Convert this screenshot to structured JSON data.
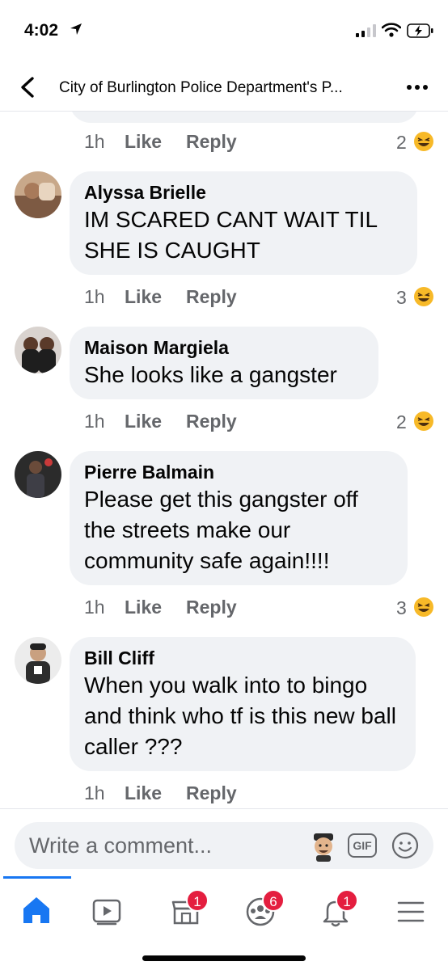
{
  "status_bar": {
    "time": "4:02"
  },
  "header": {
    "title": "City of Burlington Police Department's P..."
  },
  "comments": [
    {
      "name": "",
      "text": "",
      "time": "1h",
      "like": "Like",
      "reply": "Reply",
      "reactions": "2"
    },
    {
      "name": "Alyssa Brielle",
      "text": "IM SCARED CANT WAIT TIL SHE IS CAUGHT",
      "time": "1h",
      "like": "Like",
      "reply": "Reply",
      "reactions": "3"
    },
    {
      "name": "Maison Margiela",
      "text": "She looks like a gangster",
      "time": "1h",
      "like": "Like",
      "reply": "Reply",
      "reactions": "2"
    },
    {
      "name": "Pierre Balmain",
      "text": "Please get this gangster off the streets make our community safe again!!!!",
      "time": "1h",
      "like": "Like",
      "reply": "Reply",
      "reactions": "3"
    },
    {
      "name": "Bill Cliff",
      "text": "When you walk into to bingo and think who tf is this new ball caller ???",
      "time": "1h",
      "like": "Like",
      "reply": "Reply",
      "reactions": ""
    }
  ],
  "composer": {
    "placeholder": "Write a comment...",
    "gif_label": "GIF"
  },
  "tab_bar": {
    "badges": {
      "marketplace": "1",
      "groups": "6",
      "notifications": "1"
    }
  },
  "colors": {
    "accent": "#1877f2",
    "badge": "#e41e3f",
    "bubble": "#f0f2f5",
    "secondary_text": "#65676b"
  },
  "icons": [
    "back-arrow-icon",
    "more-icon",
    "laughing-emoji-icon",
    "avatar-sticker-icon",
    "gif-icon",
    "smiley-icon",
    "home-icon",
    "watch-icon",
    "marketplace-icon",
    "groups-icon",
    "bell-icon",
    "menu-icon"
  ]
}
